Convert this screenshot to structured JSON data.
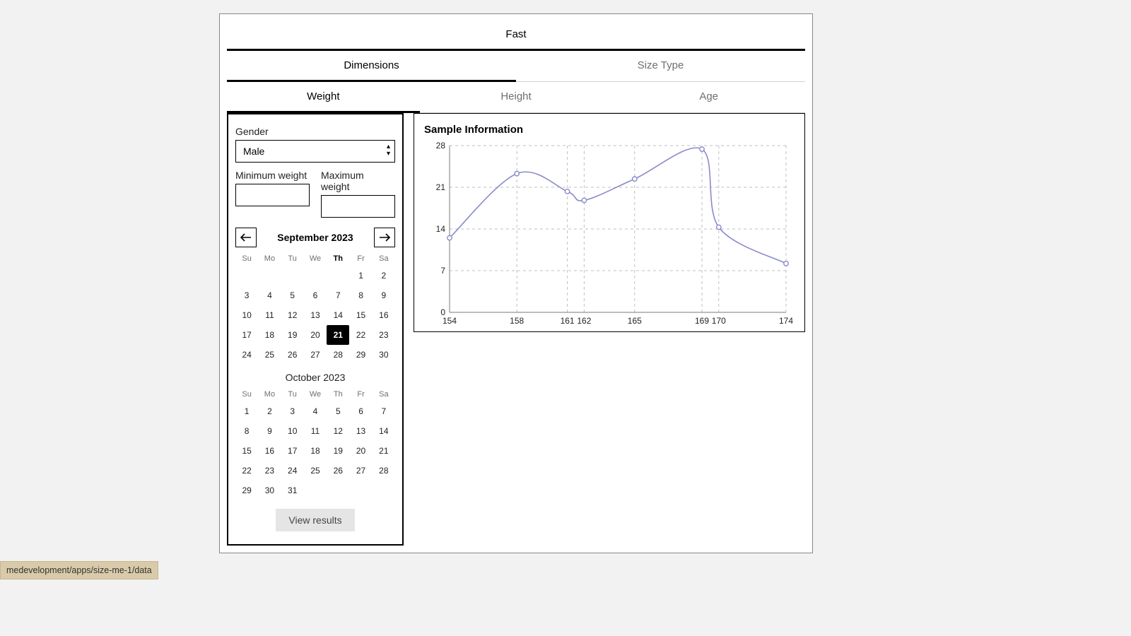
{
  "tabs_l0": [
    "Fast"
  ],
  "tabs_l1": {
    "items": [
      "Dimensions",
      "Size Type"
    ],
    "active": 0
  },
  "tabs_l2": {
    "items": [
      "Weight",
      "Height",
      "Age"
    ],
    "active": 0
  },
  "panel": {
    "gender_label": "Gender",
    "gender_value": "Male",
    "min_label": "Minimum weight",
    "max_label": "Maximum weight",
    "view_btn": "View results"
  },
  "calendar": {
    "month1_title": "September 2023",
    "month2_title": "October 2023",
    "dow": [
      "Su",
      "Mo",
      "Tu",
      "We",
      "Th",
      "Fr",
      "Sa"
    ],
    "today_dow_index": 4,
    "month1_start": 5,
    "month1_days": 30,
    "selected_day_m1": 21,
    "month2_start": 0,
    "month2_days": 31
  },
  "chart_data": {
    "type": "line",
    "title": "Sample Information",
    "x": [
      154,
      158,
      161,
      162,
      165,
      169,
      170,
      174
    ],
    "y": [
      12.5,
      23.3,
      20.3,
      18.8,
      22.4,
      27.4,
      14.3,
      8.2
    ],
    "x_ticks": [
      154,
      158,
      161,
      162,
      165,
      169,
      170,
      174
    ],
    "y_ticks": [
      0,
      7,
      14,
      21,
      28
    ],
    "xlim": [
      154,
      174
    ],
    "ylim": [
      0,
      28
    ]
  },
  "footer_text": "medevelopment/apps/size-me-1/data"
}
